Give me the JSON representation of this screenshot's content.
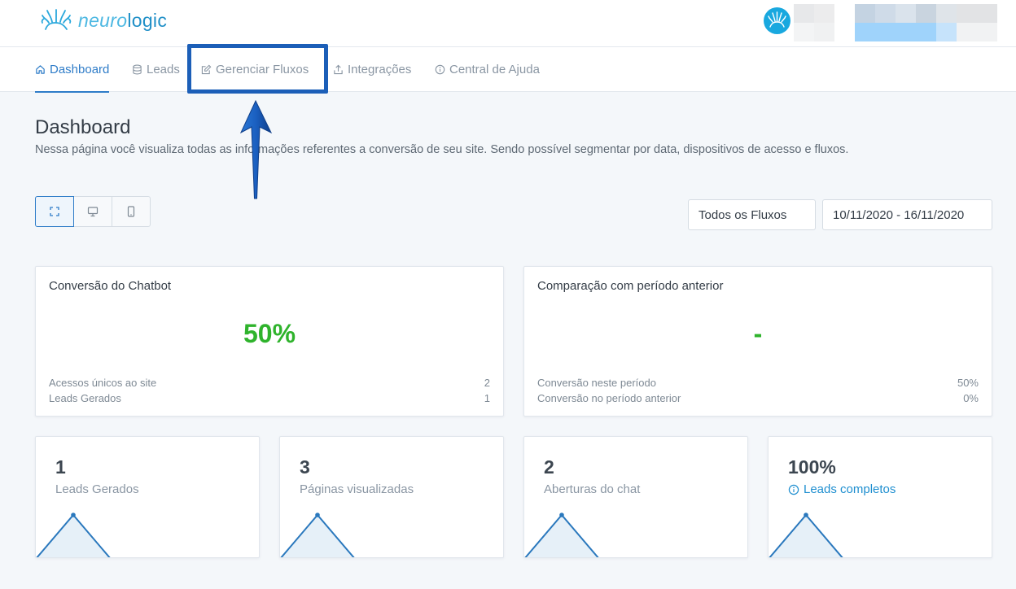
{
  "header": {
    "logo_part1": "neuro",
    "logo_part2": "logic"
  },
  "nav": {
    "items": [
      {
        "label": "Dashboard",
        "icon": "home-icon",
        "active": true
      },
      {
        "label": "Leads",
        "icon": "database-icon",
        "active": false
      },
      {
        "label": "Gerenciar Fluxos",
        "icon": "edit-icon",
        "active": false
      },
      {
        "label": "Integrações",
        "icon": "upload-icon",
        "active": false
      },
      {
        "label": "Central de Ajuda",
        "icon": "info-icon",
        "active": false
      }
    ]
  },
  "page": {
    "title": "Dashboard",
    "description": "Nessa página você visualiza todas as informações referentes a conversão de seu site. Sendo possível segmentar por data, dispositivos de acesso e fluxos."
  },
  "filters": {
    "devices": [
      "all-devices-icon",
      "desktop-icon",
      "mobile-icon"
    ],
    "flow_select": "Todos os Fluxos",
    "date_range": "10/11/2020 - 16/11/2020"
  },
  "conversion_card": {
    "title": "Conversão do Chatbot",
    "value": "50%",
    "rows": [
      {
        "label": "Acessos únicos ao site",
        "value": "2"
      },
      {
        "label": "Leads Gerados",
        "value": "1"
      }
    ]
  },
  "comparison_card": {
    "title": "Comparação com período anterior",
    "value": "-",
    "rows": [
      {
        "label": "Conversão neste período",
        "value": "50%"
      },
      {
        "label": "Conversão no período anterior",
        "value": "0%"
      }
    ]
  },
  "metrics": [
    {
      "value": "1",
      "label": "Leads Gerados"
    },
    {
      "value": "3",
      "label": "Páginas visualizadas"
    },
    {
      "value": "2",
      "label": "Aberturas do chat"
    },
    {
      "value": "100%",
      "label": "Leads completos"
    }
  ],
  "colors": {
    "accent": "#2e7cc8",
    "success": "#2fb32c",
    "annotation": "#1c5fb8"
  }
}
